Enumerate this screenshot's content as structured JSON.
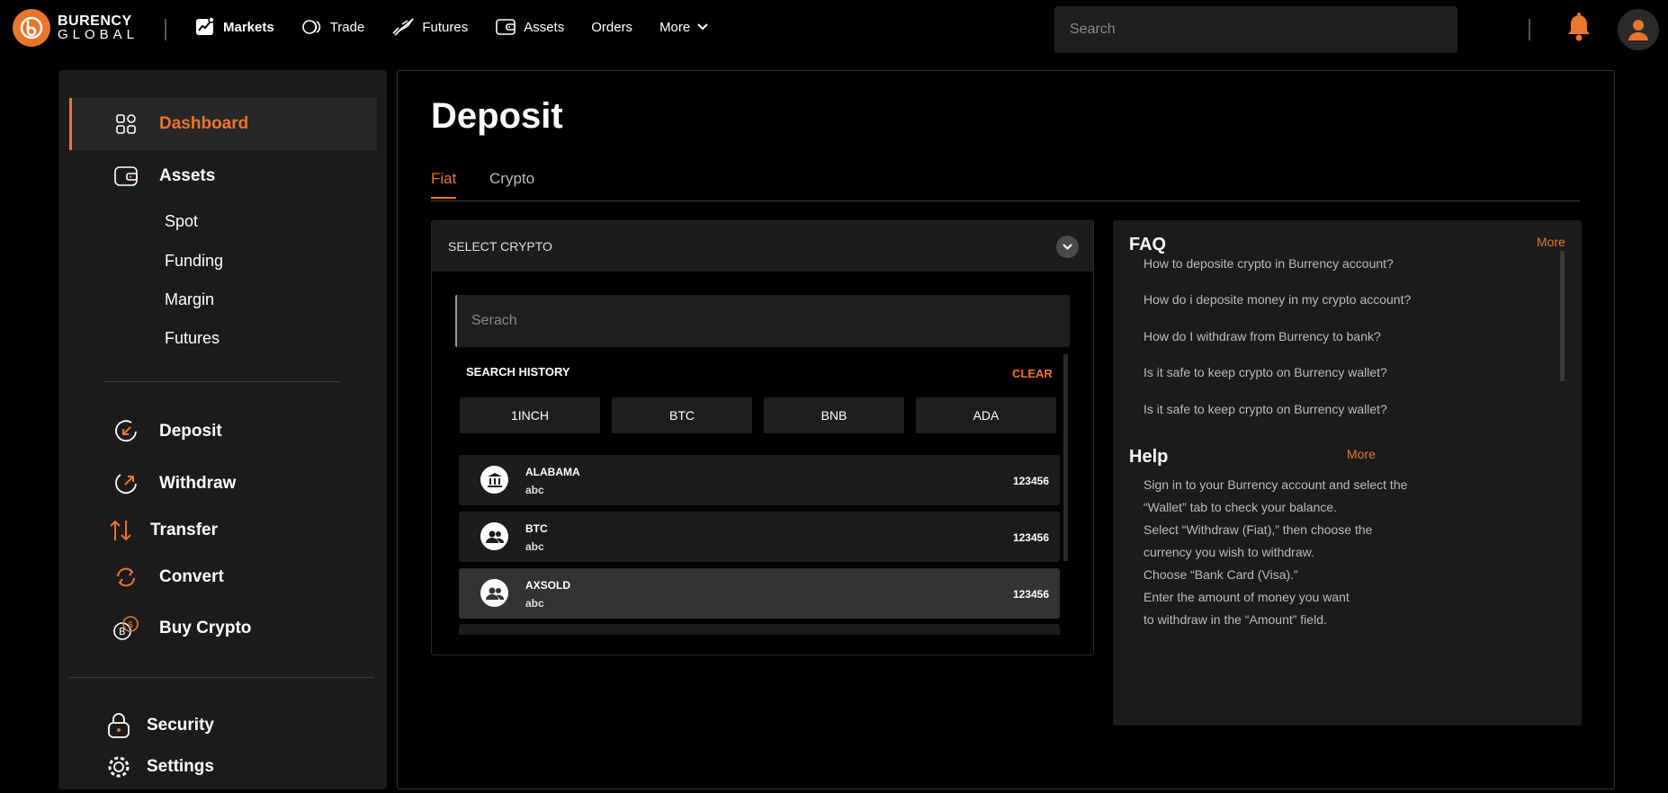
{
  "brand": {
    "line1": "BURENCY",
    "line2": "GLOBAL"
  },
  "topnav": [
    {
      "label": "Markets",
      "icon": "markets-icon"
    },
    {
      "label": "Trade",
      "icon": "trade-icon"
    },
    {
      "label": "Futures",
      "icon": "futures-icon"
    },
    {
      "label": "Assets",
      "icon": "wallet-icon"
    },
    {
      "label": "Orders"
    },
    {
      "label": "More",
      "icon": "chevron-down-icon"
    }
  ],
  "top_search": {
    "placeholder": "Search"
  },
  "colors": {
    "accent": "#e8762c",
    "background": "#000000",
    "panel": "#1b1b1b"
  },
  "sidebar": {
    "dashboard": "Dashboard",
    "assets": "Assets",
    "sub": [
      "Spot",
      "Funding",
      "Margin",
      "Futures"
    ],
    "deposit": "Deposit",
    "withdraw": "Withdraw",
    "transfer": "Transfer",
    "convert": "Convert",
    "buy_crypto": "Buy Crypto",
    "security": "Security",
    "settings": "Settings"
  },
  "page": {
    "title": "Deposit",
    "tabs": [
      "Fiat",
      "Crypto"
    ]
  },
  "select": {
    "label": "SELECT CRYPTO",
    "search_placeholder": "Serach",
    "history_label": "SEARCH HISTORY",
    "clear_label": "CLEAR",
    "chips": [
      "1INCH",
      "BTC",
      "BNB",
      "ADA"
    ],
    "rows": [
      {
        "name": "ALABAMA",
        "sub": "abc",
        "value": "123456",
        "icon": "bank-icon"
      },
      {
        "name": "BTC",
        "sub": "abc",
        "value": "123456",
        "icon": "users-icon"
      },
      {
        "name": "AXSOLD",
        "sub": "abc",
        "value": "123456",
        "icon": "users-icon"
      }
    ]
  },
  "faq": {
    "title": "FAQ",
    "more": "More",
    "questions": [
      "How to deposite crypto in Burrency account?",
      "How do i deposite money in my crypto account?",
      "How do I withdraw from Burrency to bank?",
      "Is it safe to keep crypto on Burrency wallet?",
      "Is it safe to keep crypto on Burrency wallet?"
    ]
  },
  "help": {
    "title": "Help",
    "more": "More",
    "lines": [
      "Sign in to your Burrency account and select the",
      "“Wallet” tab to check your balance.",
      "Select “Withdraw (Fiat),” then choose the",
      "currency you wish to withdraw.",
      "Choose “Bank Card (Visa).”",
      "Enter the amount of money you want",
      "to withdraw in the “Amount” field."
    ]
  }
}
